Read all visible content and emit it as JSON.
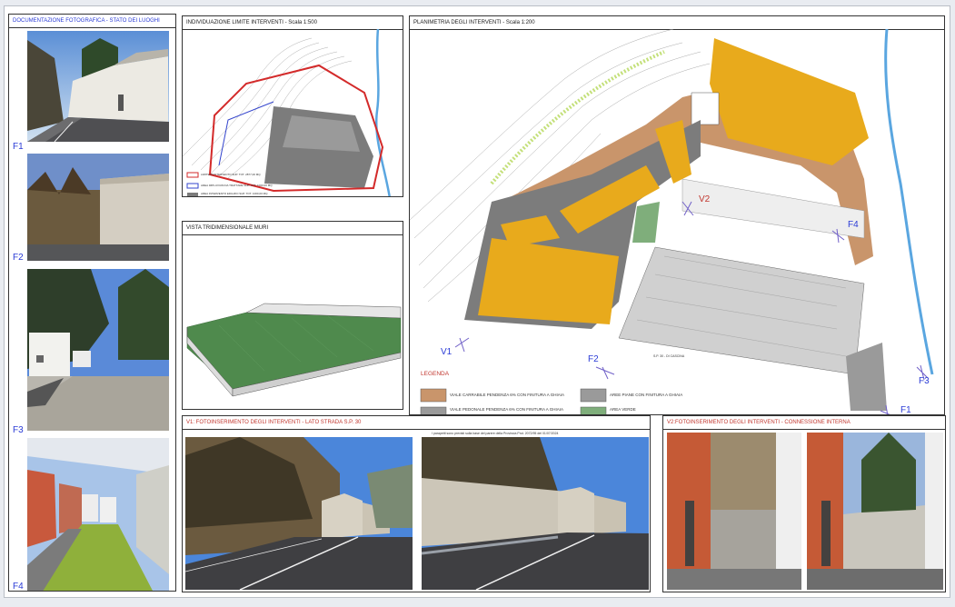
{
  "colors": {
    "road": "#c9956b",
    "paved": "#9a9a9a",
    "green": "#7fae7b",
    "yellow": "#e8aa1c",
    "accent_blue": "#2a3bd6",
    "accent_red": "#c2372f"
  },
  "panels": {
    "photo_doc": {
      "title": "DOCUMENTAZIONE FOTOGRAFICA - STATO DEI LUOGHI",
      "labels": [
        "F1",
        "F2",
        "F3",
        "F4"
      ]
    },
    "limits": {
      "title": "INDIVIDUAZIONE LIMITE INTERVENTI - Scala 1:500",
      "legend": [
        {
          "text": "LIMITE DI INTERVENTO SUP. TOT. 2877,00 MQ"
        },
        {
          "text": "AREA IMPLUVIUM DA TRATTARE SUP. TOT. 1000,00 MQ"
        },
        {
          "text": "AREA INTERVENTO EDILIZIO SUP. TOT. 1000,00 MQ"
        }
      ]
    },
    "view3d": {
      "title": "VISTA TRIDIMENSIONALE MURI"
    },
    "plan": {
      "title": "PLANIMETRIA DEGLI INTERVENTI - Scala 1:200",
      "views": [
        "V1",
        "V2",
        "F1",
        "F2",
        "F3",
        "F4"
      ],
      "road_label": "S.P. 30 - DI CASCINA",
      "legend_title": "LEGENDA",
      "legend": [
        {
          "text": "VIALE CARRABILE PENDENZA 6% CON FINITURA A GHIAIA"
        },
        {
          "text": "AREE PIANE CON FINITURA A GHIAIA"
        },
        {
          "text": "VIALE PEDONALE PENDENZA 6% CON FINITURA A GHIAIA"
        },
        {
          "text": "AREA VERDE"
        }
      ]
    },
    "v1": {
      "title": "V1: FOTOINSERIMENTO DEGLI INTERVENTI - LATO STRADA S.P. 30",
      "note": "I parapetti sono previsti sulla base del parere della Provincia Prot. 2072/95 del 01/07/2024"
    },
    "v2": {
      "title": "V2:FOTOINSERIMENTO DEGLI INTERVENTI - CONNESSIONE INTERNA"
    }
  }
}
